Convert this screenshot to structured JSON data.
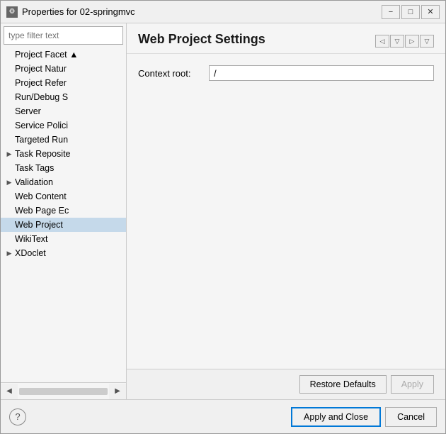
{
  "window": {
    "title": "Properties for 02-springmvc",
    "minimize_label": "−",
    "maximize_label": "□",
    "close_label": "✕"
  },
  "sidebar": {
    "filter_placeholder": "type filter text",
    "tree_items": [
      {
        "id": "project-facet",
        "label": "Project Facet ▲",
        "indent": "normal",
        "selected": false
      },
      {
        "id": "project-nature",
        "label": "Project Natur",
        "indent": "normal",
        "selected": false
      },
      {
        "id": "project-references",
        "label": "Project Refer",
        "indent": "normal",
        "selected": false
      },
      {
        "id": "run-debug",
        "label": "Run/Debug S",
        "indent": "normal",
        "selected": false
      },
      {
        "id": "server",
        "label": "Server",
        "indent": "normal",
        "selected": false
      },
      {
        "id": "service-policies",
        "label": "Service Polici",
        "indent": "normal",
        "selected": false
      },
      {
        "id": "targeted-run",
        "label": "Targeted Run",
        "indent": "normal",
        "selected": false
      },
      {
        "id": "task-repositories",
        "label": "Task Reposite",
        "indent": "expand",
        "selected": false
      },
      {
        "id": "task-tags",
        "label": "Task Tags",
        "indent": "normal",
        "selected": false
      },
      {
        "id": "validation",
        "label": "Validation",
        "indent": "expand",
        "selected": false
      },
      {
        "id": "web-content",
        "label": "Web Content",
        "indent": "normal",
        "selected": false
      },
      {
        "id": "web-page-editor",
        "label": "Web Page Ec",
        "indent": "normal",
        "selected": false
      },
      {
        "id": "web-project",
        "label": "Web Project",
        "indent": "normal",
        "selected": true
      },
      {
        "id": "wikitext",
        "label": "WikiText",
        "indent": "normal",
        "selected": false
      },
      {
        "id": "xdoclet",
        "label": "XDoclet",
        "indent": "expand",
        "selected": false
      }
    ],
    "scroll_left": "◀",
    "scroll_right": "▶"
  },
  "main_panel": {
    "title": "Web Project Settings",
    "nav_buttons": [
      "◁",
      "▽",
      "▷",
      "▽"
    ],
    "form": {
      "context_root_label": "Context root:",
      "context_root_value": "/"
    },
    "restore_defaults_label": "Restore Defaults",
    "apply_label": "Apply"
  },
  "dialog_footer": {
    "help_label": "?",
    "apply_close_label": "Apply and Close",
    "cancel_label": "Cancel"
  }
}
